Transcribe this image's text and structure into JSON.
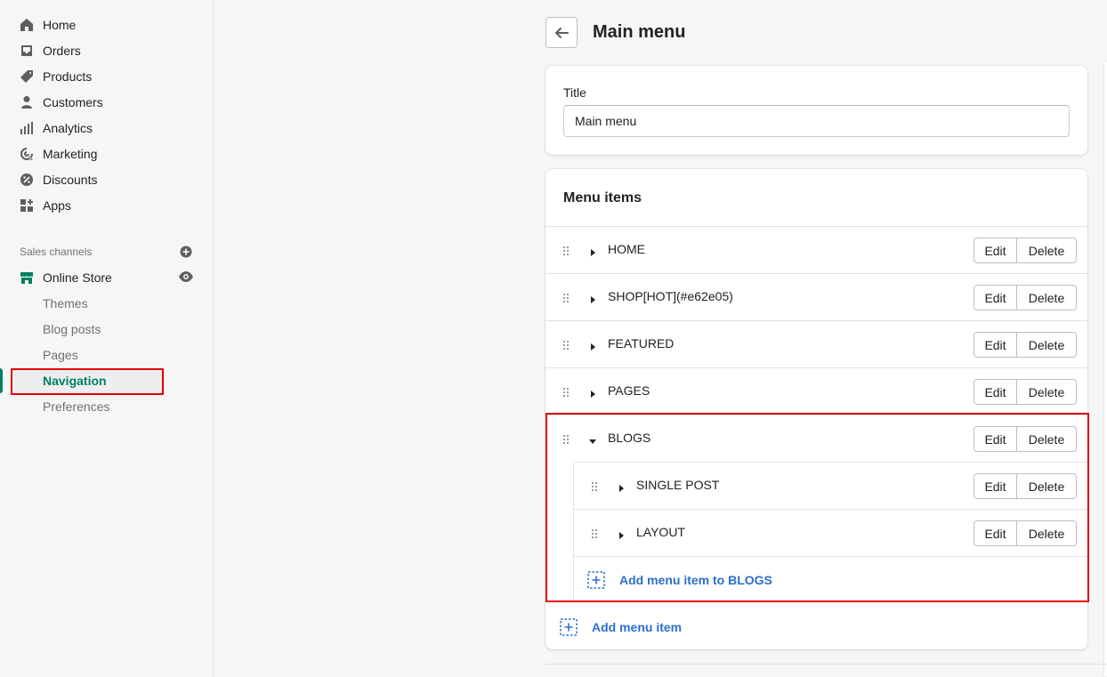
{
  "sidebar": {
    "items": [
      {
        "label": "Home",
        "icon": "home-icon"
      },
      {
        "label": "Orders",
        "icon": "orders-icon"
      },
      {
        "label": "Products",
        "icon": "tag-icon"
      },
      {
        "label": "Customers",
        "icon": "person-icon"
      },
      {
        "label": "Analytics",
        "icon": "bar-chart-icon"
      },
      {
        "label": "Marketing",
        "icon": "target-icon"
      },
      {
        "label": "Discounts",
        "icon": "discount-icon"
      },
      {
        "label": "Apps",
        "icon": "apps-icon"
      }
    ],
    "sales_channels_label": "Sales channels",
    "online_store_label": "Online Store",
    "sub_items": [
      "Themes",
      "Blog posts",
      "Pages",
      "Navigation",
      "Preferences"
    ]
  },
  "header": {
    "title": "Main menu"
  },
  "title_card": {
    "field_label": "Title",
    "field_value": "Main menu"
  },
  "menu_card": {
    "heading": "Menu items",
    "items": [
      {
        "label": "HOME",
        "expanded": false
      },
      {
        "label": "SHOP[HOT](#e62e05)",
        "expanded": false
      },
      {
        "label": "FEATURED",
        "expanded": false
      },
      {
        "label": "PAGES",
        "expanded": false
      },
      {
        "label": "BLOGS",
        "expanded": true
      }
    ],
    "children": [
      {
        "label": "SINGLE POST"
      },
      {
        "label": "LAYOUT"
      }
    ],
    "edit_label": "Edit",
    "delete_label": "Delete",
    "add_child_label": "Add menu item to BLOGS",
    "add_label": "Add menu item"
  },
  "colors": {
    "accent": "#008060",
    "link": "#2c6ecb",
    "highlight": "#e00000"
  }
}
